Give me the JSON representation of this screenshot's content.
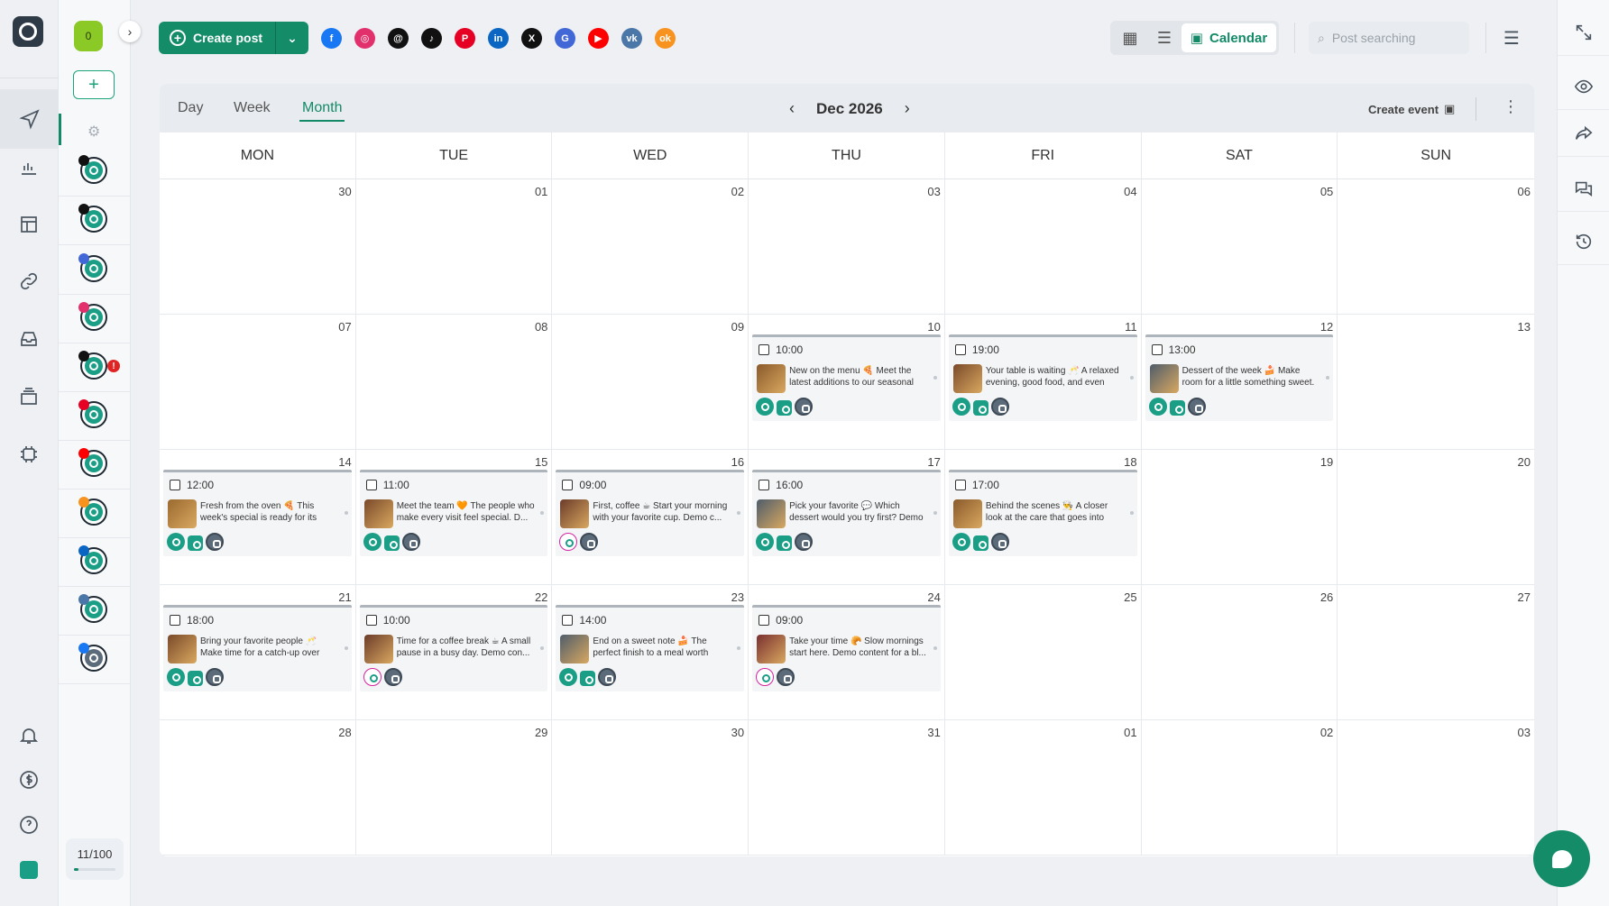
{
  "topbar": {
    "create_post_label": "Create post",
    "search_placeholder": "Post searching",
    "view_calendar_label": "Calendar",
    "social_filters": [
      {
        "name": "facebook",
        "color": "#1877f2",
        "glyph": "f"
      },
      {
        "name": "instagram",
        "color": "#e1306c",
        "glyph": "◎"
      },
      {
        "name": "threads",
        "color": "#111111",
        "glyph": "@"
      },
      {
        "name": "tiktok",
        "color": "#111111",
        "glyph": "♪"
      },
      {
        "name": "pinterest",
        "color": "#e60023",
        "glyph": "P"
      },
      {
        "name": "linkedin",
        "color": "#0a66c2",
        "glyph": "in"
      },
      {
        "name": "x",
        "color": "#111111",
        "glyph": "X"
      },
      {
        "name": "google-business",
        "color": "#4267d6",
        "glyph": "G"
      },
      {
        "name": "youtube",
        "color": "#ff0000",
        "glyph": "▶"
      },
      {
        "name": "vk",
        "color": "#4a76a8",
        "glyph": "vk"
      },
      {
        "name": "odnoklassniki",
        "color": "#f7931e",
        "glyph": "ok"
      }
    ]
  },
  "accounts": {
    "workspace_badge": "0",
    "quota": "11/100",
    "quota_fraction": 0.11,
    "list": [
      {
        "network": "threads",
        "net_color": "#111111"
      },
      {
        "network": "x",
        "net_color": "#111111"
      },
      {
        "network": "google-business",
        "net_color": "#4267d6"
      },
      {
        "network": "instagram",
        "net_color": "#e1306c"
      },
      {
        "network": "tiktok",
        "net_color": "#111111",
        "error": "!"
      },
      {
        "network": "pinterest",
        "net_color": "#e60023"
      },
      {
        "network": "youtube",
        "net_color": "#ff0000"
      },
      {
        "network": "odnoklassniki",
        "net_color": "#f7931e"
      },
      {
        "network": "linkedin",
        "net_color": "#0a66c2"
      },
      {
        "network": "vk",
        "net_color": "#4a76a8"
      },
      {
        "network": "facebook",
        "net_color": "#1877f2"
      }
    ]
  },
  "calendar": {
    "tabs": [
      "Day",
      "Week",
      "Month"
    ],
    "active_tab": "Month",
    "month_label": "Dec 2026",
    "create_event_label": "Create event",
    "weekdays": [
      "MON",
      "TUE",
      "WED",
      "THU",
      "FRI",
      "SAT",
      "SUN"
    ],
    "days": [
      "30",
      "01",
      "02",
      "03",
      "04",
      "05",
      "06",
      "07",
      "08",
      "09",
      "10",
      "11",
      "12",
      "13",
      "14",
      "15",
      "16",
      "17",
      "18",
      "19",
      "20",
      "21",
      "22",
      "23",
      "24",
      "25",
      "26",
      "27",
      "28",
      "29",
      "30",
      "31",
      "01",
      "02",
      "03"
    ],
    "posts": [
      {
        "cell": 10,
        "time": "10:00",
        "text": "New on the menu 🍕 Meet the latest additions to our seasonal men...",
        "thumb": "#8a5a2b",
        "icons": [
          "mi",
          "sq",
          "bear"
        ]
      },
      {
        "cell": 11,
        "time": "19:00",
        "text": "Your table is waiting 🥂 A relaxed evening, good food, and even bet...",
        "thumb": "#7a4a2a",
        "icons": [
          "mi",
          "sq",
          "bear"
        ]
      },
      {
        "cell": 12,
        "time": "13:00",
        "text": "Dessert of the week 🍰 Make room for a little something sweet. D...",
        "thumb": "#4f5d6b",
        "icons": [
          "mi",
          "sq",
          "bear"
        ]
      },
      {
        "cell": 14,
        "time": "12:00",
        "text": "Fresh from the oven 🍕 This week's special is ready for its close-u...",
        "thumb": "#9a6a30",
        "icons": [
          "mi",
          "sq",
          "bear"
        ]
      },
      {
        "cell": 15,
        "time": "11:00",
        "text": "Meet the team 🧡 The people who make every visit feel special. D...",
        "thumb": "#7a4a2a",
        "icons": [
          "mi",
          "sq",
          "bear"
        ]
      },
      {
        "cell": 16,
        "time": "09:00",
        "text": "First, coffee ☕ Start your morning with your favorite cup. Demo c...",
        "thumb": "#6b3b2a",
        "icons": [
          "ig",
          "bear"
        ]
      },
      {
        "cell": 17,
        "time": "16:00",
        "text": "Pick your favorite 💬 Which dessert would you try first? Demo cont...",
        "thumb": "#4f5d6b",
        "icons": [
          "mi",
          "sq",
          "bear"
        ]
      },
      {
        "cell": 18,
        "time": "17:00",
        "text": "Behind the scenes 👨‍🍳 A closer look at the care that goes into every ...",
        "thumb": "#8a5a2b",
        "icons": [
          "mi",
          "sq",
          "bear"
        ]
      },
      {
        "cell": 21,
        "time": "18:00",
        "text": "Bring your favorite people 🥂 Make time for a catch-up over dinner....",
        "thumb": "#7a4a2a",
        "icons": [
          "mi",
          "sq",
          "bear"
        ]
      },
      {
        "cell": 22,
        "time": "10:00",
        "text": "Time for a coffee break ☕ A small pause in a busy day. Demo con...",
        "thumb": "#6b3b2a",
        "icons": [
          "ig",
          "bear"
        ]
      },
      {
        "cell": 23,
        "time": "14:00",
        "text": "End on a sweet note 🍰 The perfect finish to a meal worth rememb...",
        "thumb": "#4f5d6b",
        "icons": [
          "mi",
          "sq",
          "bear"
        ]
      },
      {
        "cell": 24,
        "time": "09:00",
        "text": "Take your time 🥐 Slow mornings start here. Demo content for a bl...",
        "thumb": "#7a3030",
        "icons": [
          "ig",
          "bear"
        ]
      }
    ]
  },
  "colors": {
    "accent": "#148c68",
    "error": "#e02424"
  }
}
